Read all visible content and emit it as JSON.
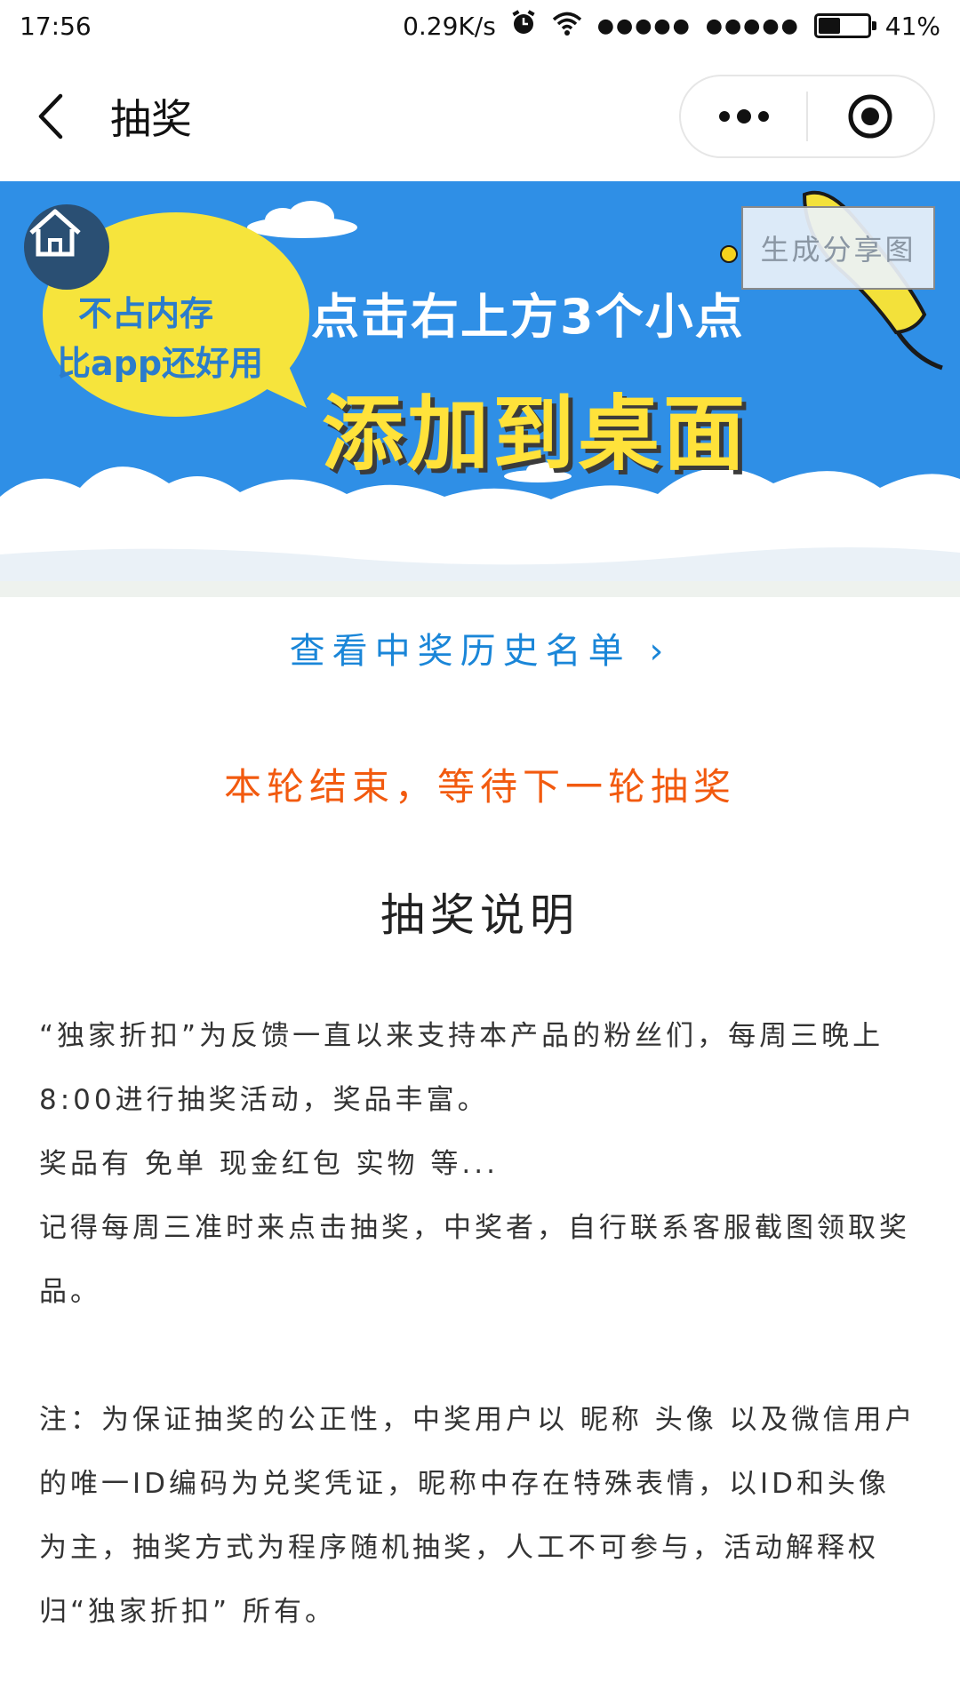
{
  "status_bar": {
    "time": "17:56",
    "network_speed": "0.29K/s",
    "battery_text": "41%",
    "battery_level": 0.41,
    "icons": [
      "alarm-icon",
      "wifi-icon",
      "signal-icon",
      "signal-icon",
      "battery-icon"
    ]
  },
  "nav": {
    "title": "抽奖",
    "back_icon": "chevron-left-icon",
    "more_icon": "more-dots-icon",
    "close_icon": "target-icon"
  },
  "banner": {
    "bubble_line1": "不占内存",
    "bubble_line2": "比app还好用",
    "headline": "点击右上方3个小点",
    "big_text": "添加到桌面",
    "home_icon": "home-icon",
    "share_button": "生成分享图",
    "colors": {
      "sky": "#2f8fe6",
      "bubble": "#f6e43c",
      "title": "#ffe23a"
    }
  },
  "history_link": "查看中奖历史名单 ›",
  "status_message": "本轮结束，等待下一轮抽奖",
  "section_title": "抽奖说明",
  "description": {
    "paragraph1": "“独家折扣”为反馈一直以来支持本产品的粉丝们，每周三晚上8:00进行抽奖活动，奖品丰富。",
    "paragraph2": "奖品有 免单 现金红包 实物 等...",
    "paragraph3": "记得每周三准时来点击抽奖，中奖者，自行联系客服截图领取奖品。",
    "paragraph4": "注：为保证抽奖的公正性，中奖用户以 昵称 头像 以及微信用户的唯一ID编码为兑奖凭证，昵称中存在特殊表情，以ID和头像为主，抽奖方式为程序随机抽奖，人工不可参与，活动解释权归“独家折扣” 所有。"
  },
  "colors": {
    "link": "#1a86d8",
    "status": "#f25a0f"
  }
}
